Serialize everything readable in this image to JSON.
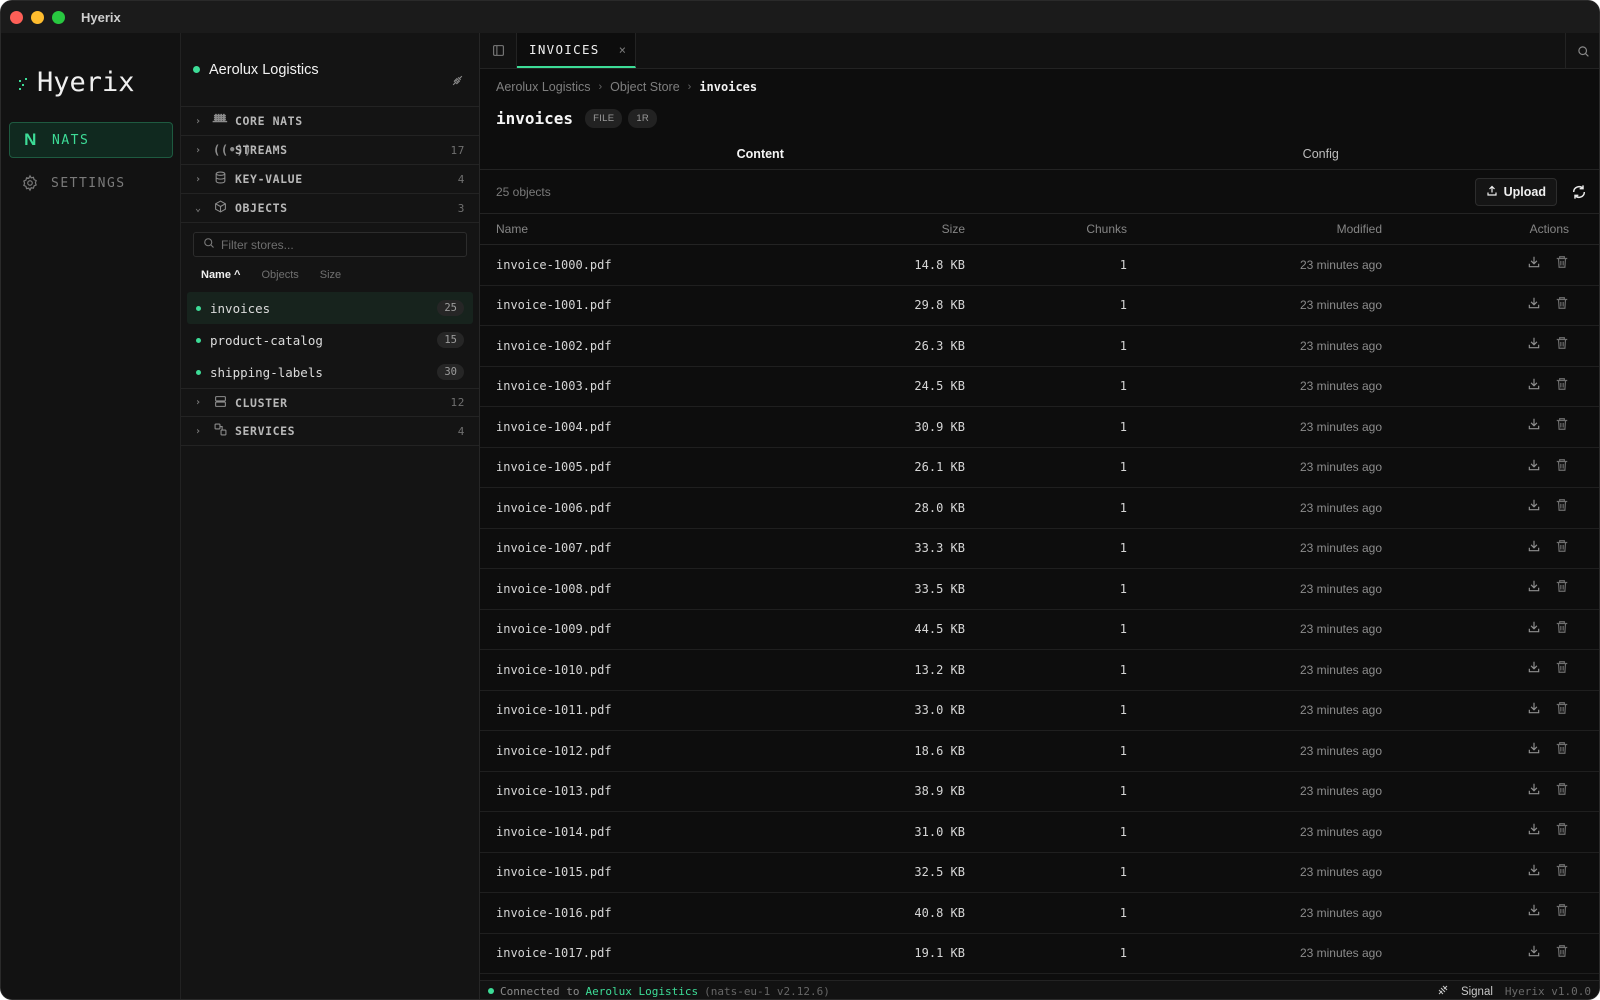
{
  "app": {
    "title": "Hyerix",
    "logo_text": "Hyerix"
  },
  "colors": {
    "accent": "#3ddc97",
    "background": "#0d0d0d"
  },
  "rail": {
    "items": [
      {
        "label": "NATS",
        "icon": "nats-n-icon",
        "active": true
      },
      {
        "label": "SETTINGS",
        "icon": "gear-icon",
        "active": false
      }
    ]
  },
  "tree": {
    "connection": "Aerolux Logistics",
    "sections": [
      {
        "label": "CORE NATS",
        "icon": "antenna-icon",
        "count": ""
      },
      {
        "label": "STREAMS",
        "icon": "broadcast-icon",
        "count": "17"
      },
      {
        "label": "KEY-VALUE",
        "icon": "database-icon",
        "count": "4"
      },
      {
        "label": "OBJECTS",
        "icon": "cube-icon",
        "count": "3"
      }
    ],
    "filter_placeholder": "Filter stores...",
    "sort": {
      "name": "Name ^",
      "objects": "Objects",
      "size": "Size"
    },
    "stores": [
      {
        "name": "invoices",
        "count": "25"
      },
      {
        "name": "product-catalog",
        "count": "15"
      },
      {
        "name": "shipping-labels",
        "count": "30"
      }
    ],
    "bottom_sections": [
      {
        "label": "CLUSTER",
        "icon": "server-icon",
        "count": "12"
      },
      {
        "label": "SERVICES",
        "icon": "services-icon",
        "count": "4"
      }
    ]
  },
  "tab": {
    "label": "INVOICES",
    "close": "×"
  },
  "breadcrumb": [
    "Aerolux Logistics",
    "Object Store",
    "invoices"
  ],
  "page": {
    "title": "invoices",
    "pills": [
      "FILE",
      "1R"
    ]
  },
  "subtabs": [
    "Content",
    "Config"
  ],
  "toolbar": {
    "count_text": "25 objects",
    "upload_label": "Upload"
  },
  "table": {
    "headers": {
      "name": "Name",
      "size": "Size",
      "chunks": "Chunks",
      "modified": "Modified",
      "actions": "Actions"
    },
    "rows": [
      {
        "name": "invoice-1000.pdf",
        "size": "14.8 KB",
        "chunks": "1",
        "modified": "23 minutes ago"
      },
      {
        "name": "invoice-1001.pdf",
        "size": "29.8 KB",
        "chunks": "1",
        "modified": "23 minutes ago"
      },
      {
        "name": "invoice-1002.pdf",
        "size": "26.3 KB",
        "chunks": "1",
        "modified": "23 minutes ago"
      },
      {
        "name": "invoice-1003.pdf",
        "size": "24.5 KB",
        "chunks": "1",
        "modified": "23 minutes ago"
      },
      {
        "name": "invoice-1004.pdf",
        "size": "30.9 KB",
        "chunks": "1",
        "modified": "23 minutes ago"
      },
      {
        "name": "invoice-1005.pdf",
        "size": "26.1 KB",
        "chunks": "1",
        "modified": "23 minutes ago"
      },
      {
        "name": "invoice-1006.pdf",
        "size": "28.0 KB",
        "chunks": "1",
        "modified": "23 minutes ago"
      },
      {
        "name": "invoice-1007.pdf",
        "size": "33.3 KB",
        "chunks": "1",
        "modified": "23 minutes ago"
      },
      {
        "name": "invoice-1008.pdf",
        "size": "33.5 KB",
        "chunks": "1",
        "modified": "23 minutes ago"
      },
      {
        "name": "invoice-1009.pdf",
        "size": "44.5 KB",
        "chunks": "1",
        "modified": "23 minutes ago"
      },
      {
        "name": "invoice-1010.pdf",
        "size": "13.2 KB",
        "chunks": "1",
        "modified": "23 minutes ago"
      },
      {
        "name": "invoice-1011.pdf",
        "size": "33.0 KB",
        "chunks": "1",
        "modified": "23 minutes ago"
      },
      {
        "name": "invoice-1012.pdf",
        "size": "18.6 KB",
        "chunks": "1",
        "modified": "23 minutes ago"
      },
      {
        "name": "invoice-1013.pdf",
        "size": "38.9 KB",
        "chunks": "1",
        "modified": "23 minutes ago"
      },
      {
        "name": "invoice-1014.pdf",
        "size": "31.0 KB",
        "chunks": "1",
        "modified": "23 minutes ago"
      },
      {
        "name": "invoice-1015.pdf",
        "size": "32.5 KB",
        "chunks": "1",
        "modified": "23 minutes ago"
      },
      {
        "name": "invoice-1016.pdf",
        "size": "40.8 KB",
        "chunks": "1",
        "modified": "23 minutes ago"
      },
      {
        "name": "invoice-1017.pdf",
        "size": "19.1 KB",
        "chunks": "1",
        "modified": "23 minutes ago"
      }
    ]
  },
  "status": {
    "prefix": "Connected to",
    "connection": "Aerolux Logistics",
    "detail": "(nats-eu-1 v2.12.6)",
    "signal": "Signal",
    "version": "Hyerix v1.0.0"
  }
}
